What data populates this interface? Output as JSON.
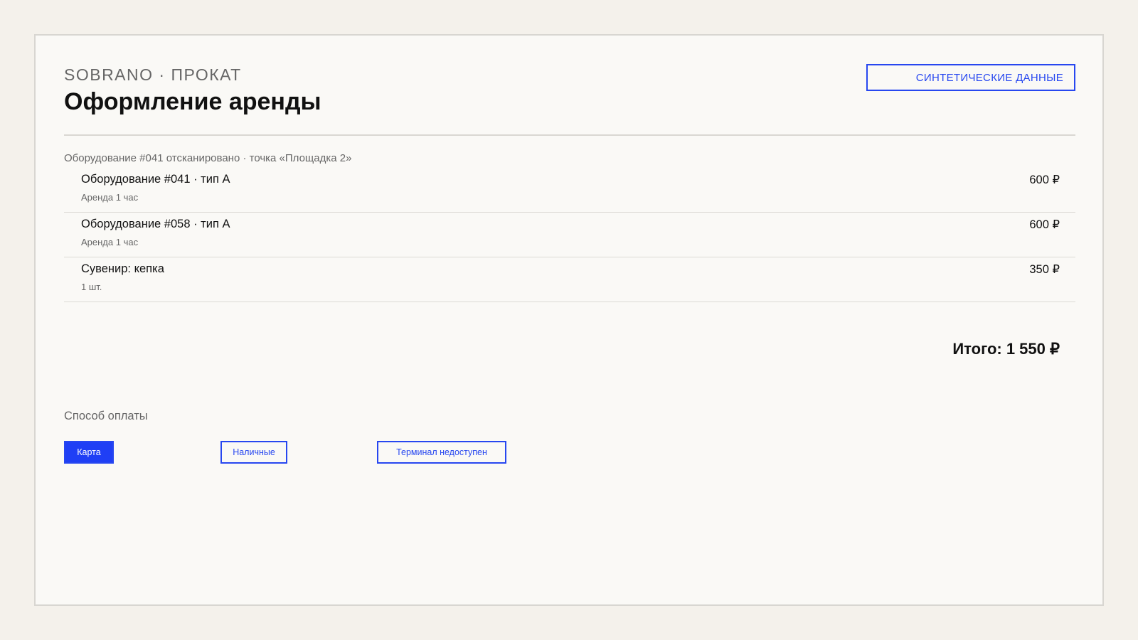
{
  "header": {
    "brand": "SOBRANO · ПРОКАТ",
    "title": "Оформление аренды",
    "badge": "СИНТЕТИЧЕСКИЕ ДАННЫЕ"
  },
  "scan_status": "Оборудование #041 отсканировано · точка «Площадка 2»",
  "items": [
    {
      "name": "Оборудование #041 · тип A",
      "sub": "Аренда 1 час",
      "price": "600 ₽"
    },
    {
      "name": "Оборудование #058 · тип A",
      "sub": "Аренда 1 час",
      "price": "600 ₽"
    },
    {
      "name": "Сувенир: кепка",
      "sub": "1 шт.",
      "price": "350 ₽"
    }
  ],
  "total": "Итого: 1 550 ₽",
  "payment": {
    "label": "Способ оплаты",
    "options": [
      {
        "label": "Карта",
        "selected": true
      },
      {
        "label": "Наличные",
        "selected": false
      },
      {
        "label": "Терминал недоступен",
        "selected": false
      }
    ]
  },
  "colors": {
    "accent": "#1f3ff5",
    "page_background": "#f4f1eb",
    "panel_background": "#faf9f6"
  }
}
